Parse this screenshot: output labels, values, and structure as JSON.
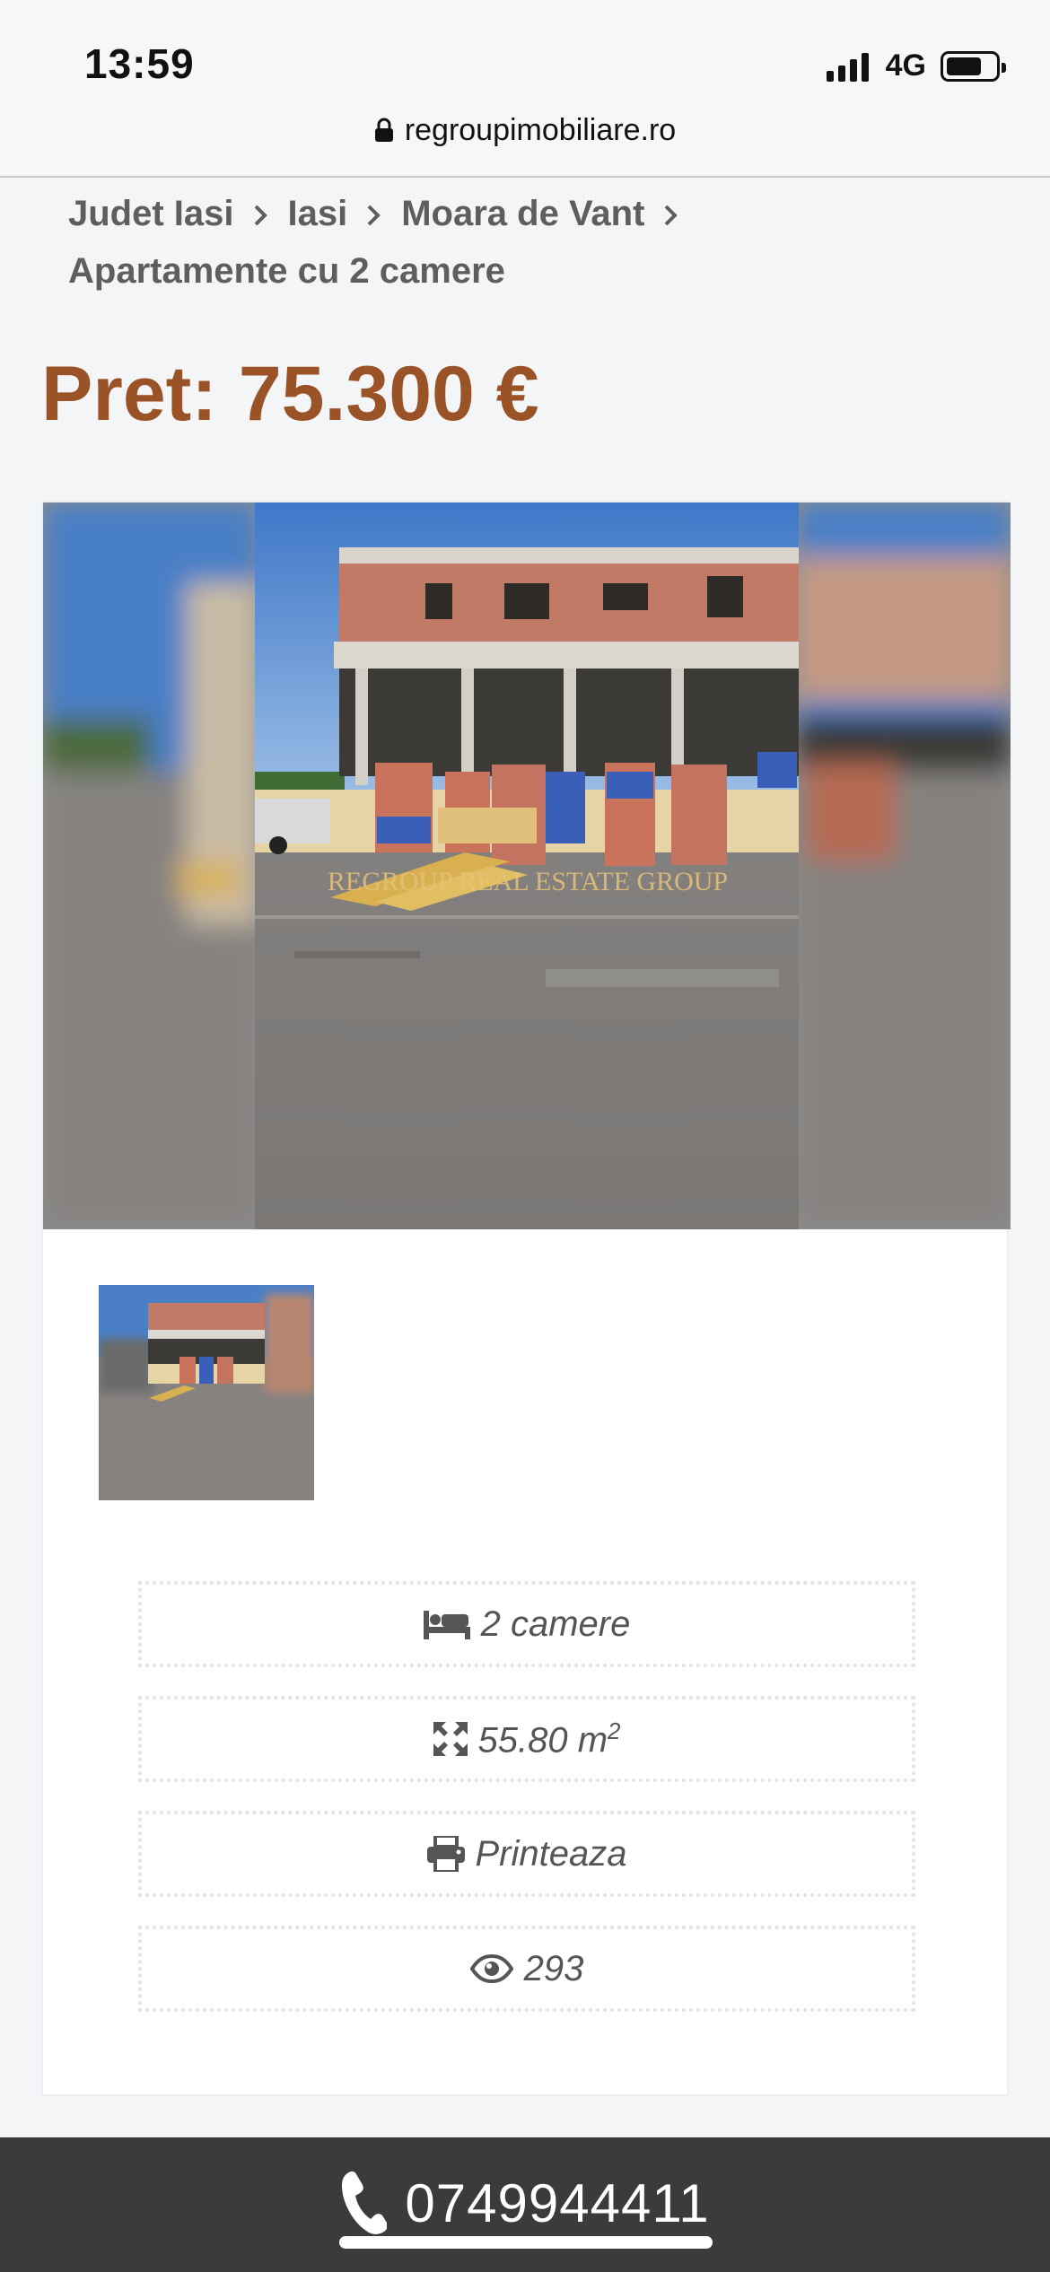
{
  "status_bar": {
    "time": "13:59",
    "network": "4G"
  },
  "url_bar": {
    "domain": "regroupimobiliare.ro"
  },
  "breadcrumb": {
    "items": [
      "Judet Iasi",
      "Iasi",
      "Moara de Vant",
      "Apartamente cu 2 camere"
    ]
  },
  "listing": {
    "price": "Pret: 75.300 €",
    "watermark": "REGROUP REAL ESTATE GROUP"
  },
  "details": {
    "rooms": "2 camere",
    "area_value": "55.80 m",
    "area_exp": "2",
    "print_label": "Printeaza",
    "views": "293"
  },
  "contact": {
    "phone": "0749944411"
  },
  "colors": {
    "price": "#9a5327",
    "callbar": "#3b3b3b"
  }
}
